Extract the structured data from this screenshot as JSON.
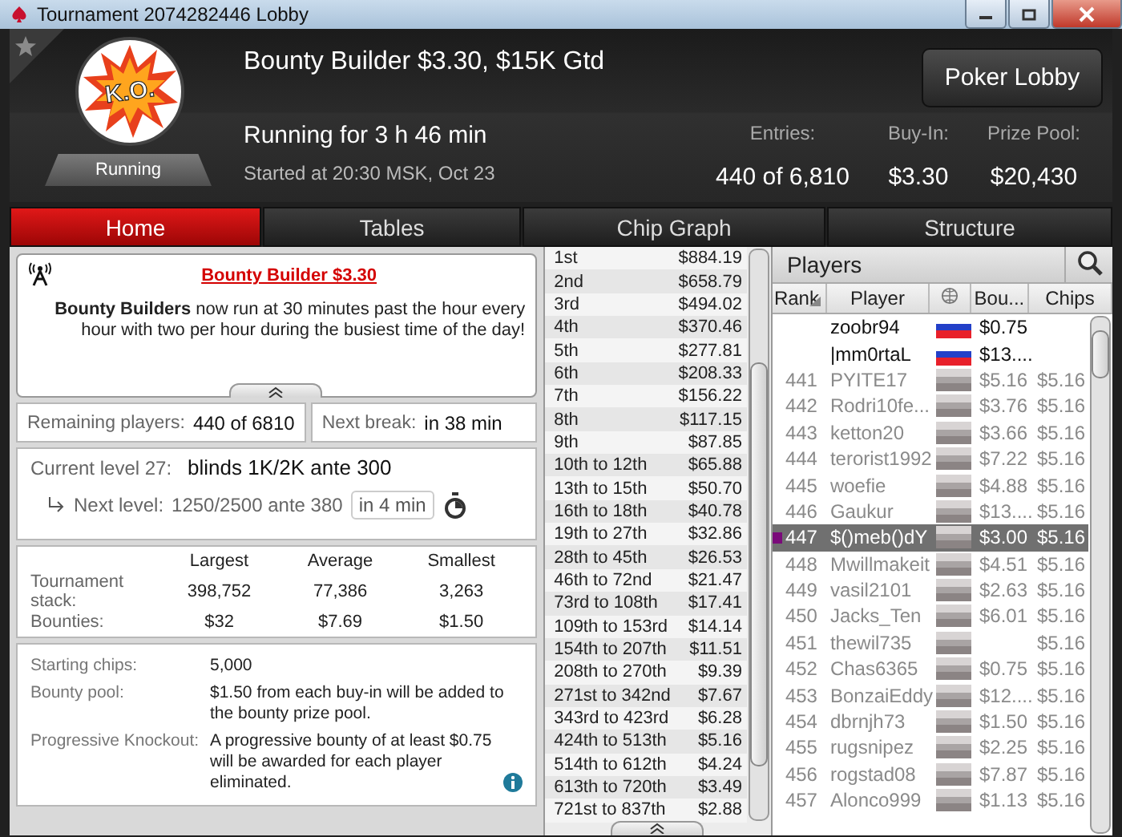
{
  "window": {
    "title": "Tournament 2074282446 Lobby"
  },
  "header": {
    "logo_text": "K.O.",
    "status": "Running",
    "title": "Bounty Builder $3.30, $15K Gtd",
    "running_for": "Running for 3 h 46 min",
    "started": "Started at 20:30 MSK, Oct 23",
    "lobby_button": "Poker Lobby",
    "stats": [
      {
        "label": "Entries:",
        "value": "440 of 6,810"
      },
      {
        "label": "Buy-In:",
        "value": "$3.30"
      },
      {
        "label": "Prize Pool:",
        "value": "$20,430"
      }
    ]
  },
  "tabs": [
    {
      "label": "Home",
      "selected": true
    },
    {
      "label": "Tables",
      "selected": false
    },
    {
      "label": "Chip Graph",
      "selected": false
    },
    {
      "label": "Structure",
      "selected": false
    }
  ],
  "news": {
    "title": "Bounty Builder $3.30",
    "text": "**Bounty Builders** now run at 30 minutes past the hour every hour with two per hour during the busiest time of the day!"
  },
  "remaining": {
    "label": "Remaining players:",
    "value": "440 of 6810"
  },
  "next_break": {
    "label": "Next break:",
    "value": "in 38 min"
  },
  "level": {
    "label": "Current level 27:",
    "value": "blinds 1K/2K ante 300",
    "next_label": "Next level:",
    "next_value": "1250/2500 ante 380",
    "next_in": "in 4 min"
  },
  "stacks": {
    "columns": [
      "Largest",
      "Average",
      "Smallest"
    ],
    "rows": [
      {
        "label": "Tournament stack:",
        "values": [
          "398,752",
          "77,386",
          "3,263"
        ]
      },
      {
        "label": "Bounties:",
        "values": [
          "$32",
          "$7.69",
          "$1.50"
        ]
      }
    ]
  },
  "info": [
    {
      "label": "Starting chips:",
      "value": "5,000",
      "info": false
    },
    {
      "label": "Bounty pool:",
      "value": "$1.50 from each buy-in will be added to the bounty prize pool.",
      "info": false
    },
    {
      "label": "Progressive Knockout:",
      "value": "A progressive bounty of at least $0.75 will be awarded for each player eliminated.",
      "info": true
    }
  ],
  "payouts": [
    {
      "place": "1st",
      "prize": "$884.19"
    },
    {
      "place": "2nd",
      "prize": "$658.79"
    },
    {
      "place": "3rd",
      "prize": "$494.02"
    },
    {
      "place": "4th",
      "prize": "$370.46"
    },
    {
      "place": "5th",
      "prize": "$277.81"
    },
    {
      "place": "6th",
      "prize": "$208.33"
    },
    {
      "place": "7th",
      "prize": "$156.22"
    },
    {
      "place": "8th",
      "prize": "$117.15"
    },
    {
      "place": "9th",
      "prize": "$87.85"
    },
    {
      "place": "10th to 12th",
      "prize": "$65.88"
    },
    {
      "place": "13th to 15th",
      "prize": "$50.70"
    },
    {
      "place": "16th to 18th",
      "prize": "$40.78"
    },
    {
      "place": "19th to 27th",
      "prize": "$32.86"
    },
    {
      "place": "28th to 45th",
      "prize": "$26.53"
    },
    {
      "place": "46th to 72nd",
      "prize": "$21.47"
    },
    {
      "place": "73rd to 108th",
      "prize": "$17.41"
    },
    {
      "place": "109th to 153rd",
      "prize": "$14.14"
    },
    {
      "place": "154th to 207th",
      "prize": "$11.51"
    },
    {
      "place": "208th to 270th",
      "prize": "$9.39"
    },
    {
      "place": "271st to 342nd",
      "prize": "$7.67"
    },
    {
      "place": "343rd to 423rd",
      "prize": "$6.28"
    },
    {
      "place": "424th to 513th",
      "prize": "$5.16"
    },
    {
      "place": "514th to 612th",
      "prize": "$4.24"
    },
    {
      "place": "613th to 720th",
      "prize": "$3.49"
    },
    {
      "place": "721st to 837th",
      "prize": "$2.88"
    }
  ],
  "players": {
    "title": "Players",
    "columns": [
      {
        "label": "Rank",
        "sorted": true
      },
      {
        "label": "Player",
        "sorted": false
      },
      {
        "label": "Bou...",
        "sorted": false
      },
      {
        "label": "Chips",
        "sorted": false
      }
    ],
    "rows": [
      {
        "name": "zoobr94",
        "bounty": "$0.75",
        "kind": "knocked-out",
        "selected": false
      },
      {
        "name": "|mm0rtaL",
        "bounty": "$13....",
        "kind": "knocked-out",
        "selected": false
      },
      {
        "rank": "441",
        "name": "PYITE17",
        "bounty": "$5.16",
        "chips": "$5.16",
        "kind": "active",
        "selected": false
      },
      {
        "rank": "442",
        "name": "Rodri10fe...",
        "bounty": "$3.76",
        "chips": "$5.16",
        "kind": "active",
        "selected": false
      },
      {
        "rank": "443",
        "name": "ketton20",
        "bounty": "$3.66",
        "chips": "$5.16",
        "kind": "active",
        "selected": false
      },
      {
        "rank": "444",
        "name": "terorist1992",
        "bounty": "$7.22",
        "chips": "$5.16",
        "kind": "active",
        "selected": false
      },
      {
        "rank": "445",
        "name": "woefie",
        "bounty": "$4.88",
        "chips": "$5.16",
        "kind": "active",
        "selected": false
      },
      {
        "rank": "446",
        "name": "Gaukur",
        "bounty": "$13....",
        "chips": "$5.16",
        "kind": "active",
        "selected": false
      },
      {
        "rank": "447",
        "name": "$()meb()dY",
        "bounty": "$3.00",
        "chips": "$5.16",
        "kind": "active",
        "selected": true,
        "color": "#7a0a7a"
      },
      {
        "rank": "448",
        "name": "Mwillmakeit",
        "bounty": "$4.51",
        "chips": "$5.16",
        "kind": "active",
        "selected": false
      },
      {
        "rank": "449",
        "name": "vasil2101",
        "bounty": "$2.63",
        "chips": "$5.16",
        "kind": "active",
        "selected": false
      },
      {
        "rank": "450",
        "name": "Jacks_Ten",
        "bounty": "$6.01",
        "chips": "$5.16",
        "kind": "active",
        "selected": false
      },
      {
        "rank": "451",
        "name": "thewil735",
        "chips": "$5.16",
        "kind": "active",
        "selected": false
      },
      {
        "rank": "452",
        "name": "Chas6365",
        "bounty": "$0.75",
        "chips": "$5.16",
        "kind": "active",
        "selected": false
      },
      {
        "rank": "453",
        "name": "BonzaiEddy",
        "bounty": "$12....",
        "chips": "$5.16",
        "kind": "active",
        "selected": false
      },
      {
        "rank": "454",
        "name": "dbrnjh73",
        "bounty": "$1.50",
        "chips": "$5.16",
        "kind": "active",
        "selected": false
      },
      {
        "rank": "455",
        "name": "rugsnipez",
        "bounty": "$2.25",
        "chips": "$5.16",
        "kind": "active",
        "selected": false
      },
      {
        "rank": "456",
        "name": "rogstad08",
        "bounty": "$7.87",
        "chips": "$5.16",
        "kind": "active",
        "selected": false
      },
      {
        "rank": "457",
        "name": "Alonco999",
        "bounty": "$1.13",
        "chips": "$5.16",
        "kind": "active",
        "selected": false
      }
    ]
  }
}
